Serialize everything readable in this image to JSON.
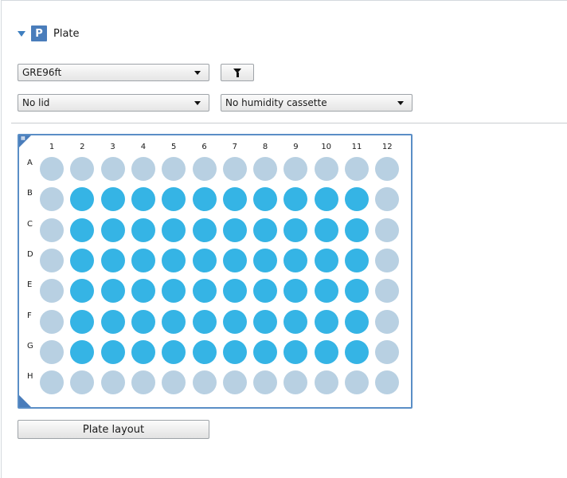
{
  "header": {
    "badge": "P",
    "title": "Plate"
  },
  "plate_type_combo": {
    "value": "GRE96ft"
  },
  "lid_combo": {
    "value": "No lid"
  },
  "humidity_combo": {
    "value": "No humidity cassette"
  },
  "plate": {
    "columns": [
      "1",
      "2",
      "3",
      "4",
      "5",
      "6",
      "7",
      "8",
      "9",
      "10",
      "11",
      "12"
    ],
    "rows": [
      "A",
      "B",
      "C",
      "D",
      "E",
      "F",
      "G",
      "H"
    ],
    "selected_color": "#35b4e5",
    "unselected_color": "#b8d0e2",
    "selected_wells": [
      "B2",
      "B3",
      "B4",
      "B5",
      "B6",
      "B7",
      "B8",
      "B9",
      "B10",
      "B11",
      "C2",
      "C3",
      "C4",
      "C5",
      "C6",
      "C7",
      "C8",
      "C9",
      "C10",
      "C11",
      "D2",
      "D3",
      "D4",
      "D5",
      "D6",
      "D7",
      "D8",
      "D9",
      "D10",
      "D11",
      "E2",
      "E3",
      "E4",
      "E5",
      "E6",
      "E7",
      "E8",
      "E9",
      "E10",
      "E11",
      "F2",
      "F3",
      "F4",
      "F5",
      "F6",
      "F7",
      "F8",
      "F9",
      "F10",
      "F11",
      "G2",
      "G3",
      "G4",
      "G5",
      "G6",
      "G7",
      "G8",
      "G9",
      "G10",
      "G11"
    ]
  },
  "buttons": {
    "plate_layout": "Plate layout"
  },
  "icons": {
    "expand": "triangle-down-icon",
    "filter": "filter-icon",
    "dropdown": "chevron-down-icon"
  }
}
